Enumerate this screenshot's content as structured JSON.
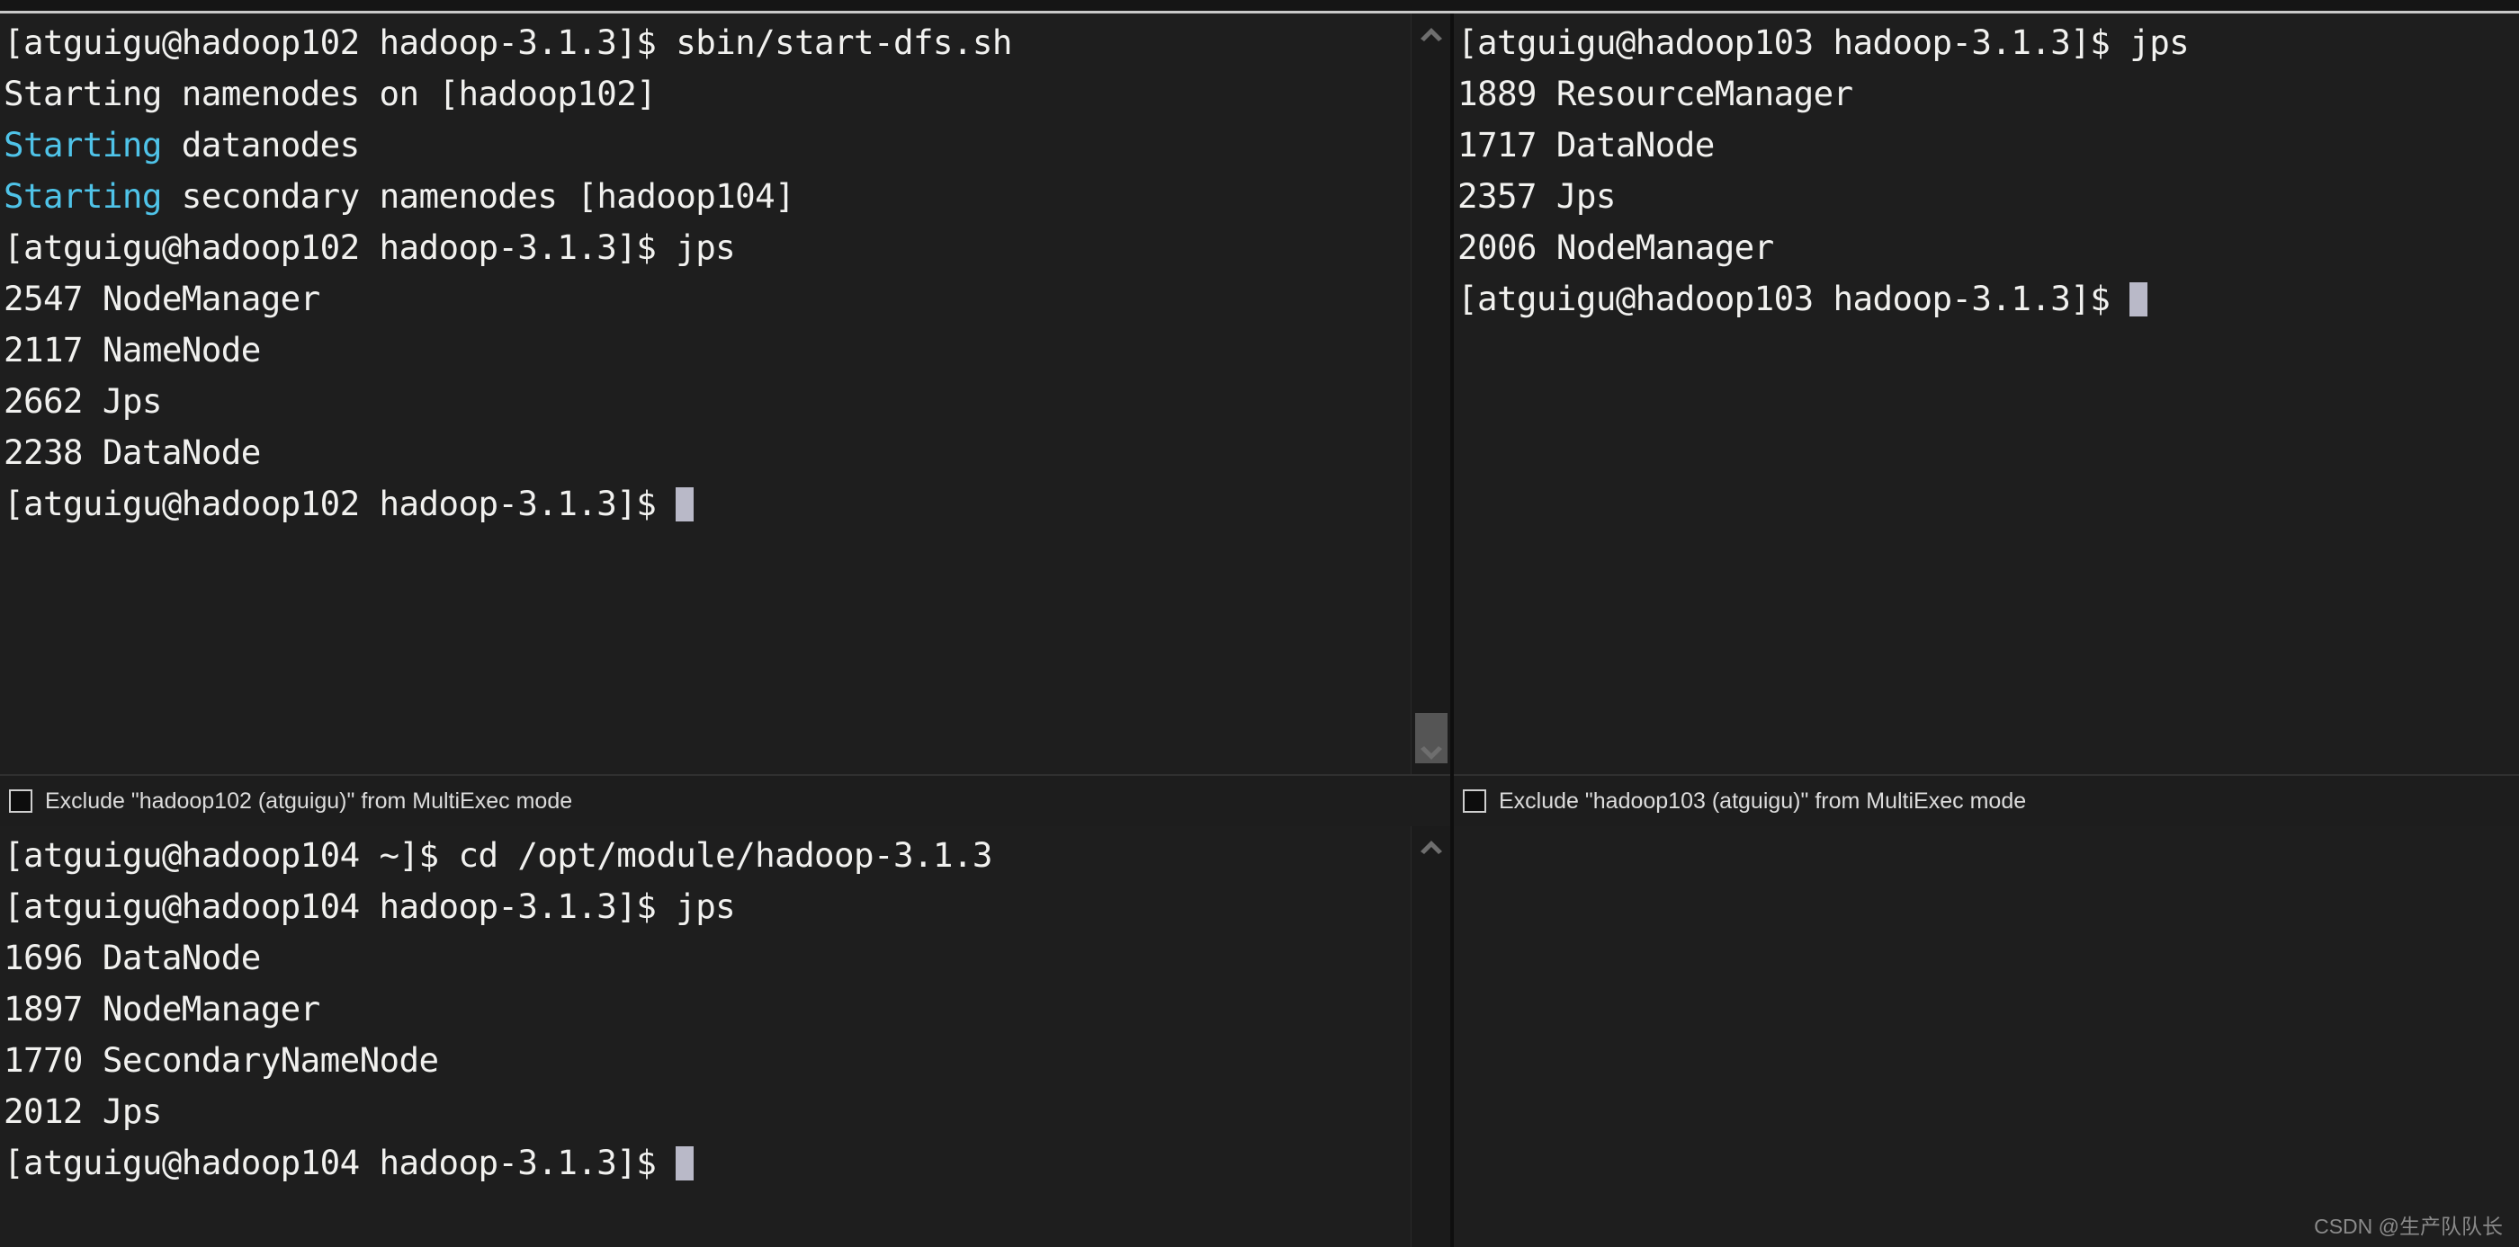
{
  "app": {
    "name": "xshell-multi-terminal",
    "watermark": "CSDN @生产队队长"
  },
  "colors": {
    "background": "#1e1e1e",
    "foreground": "#f1f1ef",
    "cyan": "#4fc3e8",
    "cursor": "#b9b9c8",
    "scrollbar_thumb": "#555555",
    "divider": "#0e0e0e"
  },
  "panes": [
    {
      "id": "pane-hadoop102",
      "host": "hadoop102",
      "user": "atguigu",
      "lines": [
        [
          {
            "text": "[atguigu@hadoop102 hadoop-3.1.3]$ sbin/start-dfs.sh",
            "color": "default"
          }
        ],
        [
          {
            "text": "Starting namenodes on [hadoop102]",
            "color": "default"
          }
        ],
        [
          {
            "text": "Starting",
            "color": "cyan"
          },
          {
            "text": " datanodes",
            "color": "default"
          }
        ],
        [
          {
            "text": "Starting",
            "color": "cyan"
          },
          {
            "text": " secondary namenodes [hadoop104]",
            "color": "default"
          }
        ],
        [
          {
            "text": "[atguigu@hadoop102 hadoop-3.1.3]$ jps",
            "color": "default"
          }
        ],
        [
          {
            "text": "2547 NodeManager",
            "color": "default"
          }
        ],
        [
          {
            "text": "2117 NameNode",
            "color": "default"
          }
        ],
        [
          {
            "text": "2662 Jps",
            "color": "default"
          }
        ],
        [
          {
            "text": "2238 DataNode",
            "color": "default"
          }
        ],
        [
          {
            "text": "[atguigu@hadoop102 hadoop-3.1.3]$ ",
            "color": "default",
            "cursor": true
          }
        ]
      ],
      "checkbox": {
        "label": "Exclude \"hadoop102 (atguigu)\" from MultiExec mode",
        "checked": false
      },
      "scrollbar": {
        "visible": true,
        "up_arrow": true,
        "down_arrow": true,
        "thumb": true
      }
    },
    {
      "id": "pane-hadoop103",
      "host": "hadoop103",
      "user": "atguigu",
      "lines": [
        [
          {
            "text": "[atguigu@hadoop103 hadoop-3.1.3]$ jps",
            "color": "default"
          }
        ],
        [
          {
            "text": "1889 ResourceManager",
            "color": "default"
          }
        ],
        [
          {
            "text": "1717 DataNode",
            "color": "default"
          }
        ],
        [
          {
            "text": "2357 Jps",
            "color": "default"
          }
        ],
        [
          {
            "text": "2006 NodeManager",
            "color": "default"
          }
        ],
        [
          {
            "text": "[atguigu@hadoop103 hadoop-3.1.3]$ ",
            "color": "default",
            "cursor": true
          }
        ]
      ],
      "checkbox": {
        "label": "Exclude \"hadoop103 (atguigu)\" from MultiExec mode",
        "checked": false
      },
      "scrollbar": {
        "visible": false,
        "up_arrow": false,
        "down_arrow": false,
        "thumb": false
      }
    },
    {
      "id": "pane-hadoop104",
      "host": "hadoop104",
      "user": "atguigu",
      "lines": [
        [
          {
            "text": "[atguigu@hadoop104 ~]$ cd /opt/module/hadoop-3.1.3",
            "color": "default"
          }
        ],
        [
          {
            "text": "[atguigu@hadoop104 hadoop-3.1.3]$ jps",
            "color": "default"
          }
        ],
        [
          {
            "text": "1696 DataNode",
            "color": "default"
          }
        ],
        [
          {
            "text": "1897 NodeManager",
            "color": "default"
          }
        ],
        [
          {
            "text": "1770 SecondaryNameNode",
            "color": "default"
          }
        ],
        [
          {
            "text": "2012 Jps",
            "color": "default"
          }
        ],
        [
          {
            "text": "[atguigu@hadoop104 hadoop-3.1.3]$ ",
            "color": "default",
            "cursor": true
          }
        ]
      ],
      "checkbox": null,
      "scrollbar": {
        "visible": true,
        "up_arrow": true,
        "down_arrow": false,
        "thumb": false
      }
    },
    {
      "id": "pane-empty",
      "host": "",
      "user": "",
      "lines": [],
      "checkbox": null,
      "scrollbar": {
        "visible": false,
        "up_arrow": false,
        "down_arrow": false,
        "thumb": false
      }
    }
  ]
}
